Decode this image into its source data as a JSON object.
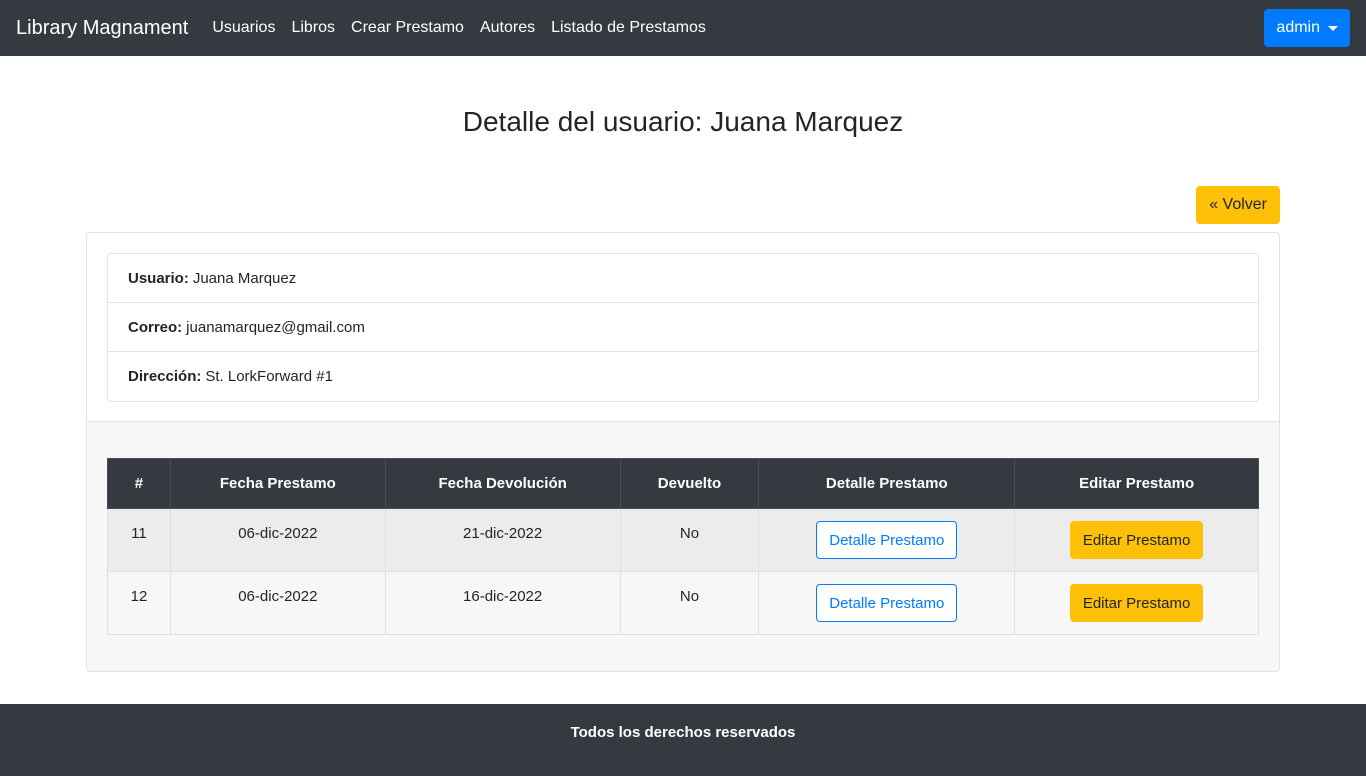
{
  "navbar": {
    "brand": "Library Magnament",
    "links": [
      "Usuarios",
      "Libros",
      "Crear Prestamo",
      "Autores",
      "Listado de Prestamos"
    ],
    "user_menu": "admin"
  },
  "page": {
    "title": "Detalle del usuario: Juana Marquez",
    "back_label": "« Volver"
  },
  "user": {
    "usuario_label": "Usuario:",
    "usuario": "Juana Marquez",
    "correo_label": "Correo:",
    "correo": "juanamarquez@gmail.com",
    "direccion_label": "Dirección:",
    "direccion": "St. LorkForward #1"
  },
  "loans_table": {
    "headers": [
      "#",
      "Fecha Prestamo",
      "Fecha Devolución",
      "Devuelto",
      "Detalle Prestamo",
      "Editar Prestamo"
    ],
    "rows": [
      {
        "id": "11",
        "fecha_prestamo": "06-dic-2022",
        "fecha_devolucion": "21-dic-2022",
        "devuelto": "No",
        "detalle_label": "Detalle Prestamo",
        "editar_label": "Editar Prestamo"
      },
      {
        "id": "12",
        "fecha_prestamo": "06-dic-2022",
        "fecha_devolucion": "16-dic-2022",
        "devuelto": "No",
        "detalle_label": "Detalle Prestamo",
        "editar_label": "Editar Prestamo"
      }
    ]
  },
  "footer": {
    "text": "Todos los derechos reservados"
  },
  "colors": {
    "navbar_bg": "#343a40",
    "primary": "#007bff",
    "warning": "#ffc107"
  }
}
